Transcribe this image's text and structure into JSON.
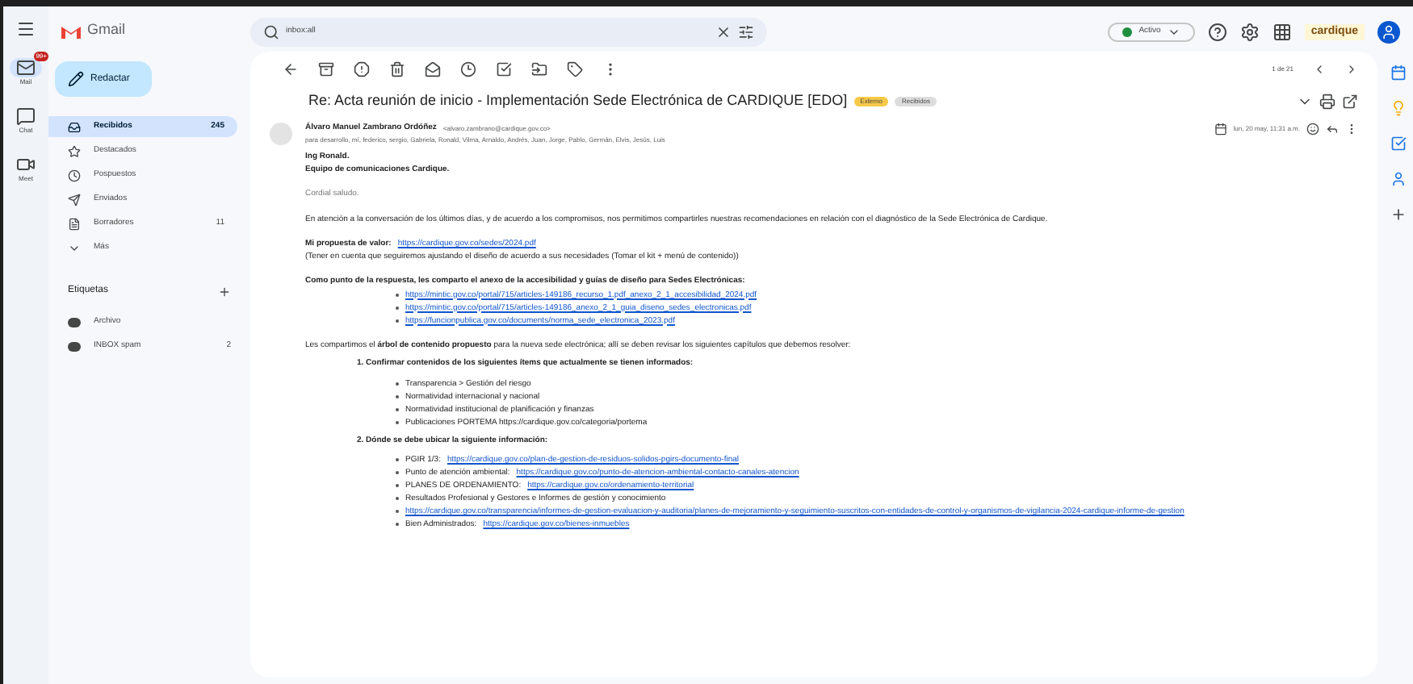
{
  "rail": [
    {
      "label": "Mail",
      "badge": "99+",
      "selected": true
    },
    {
      "label": "Chat",
      "selected": false
    },
    {
      "label": "Meet",
      "selected": false
    }
  ],
  "app_name": "Gmail",
  "compose": "Redactar",
  "folders": [
    {
      "label": "Recibidos",
      "count": "245",
      "selected": true
    },
    {
      "label": "Destacados",
      "selected": false
    },
    {
      "label": "Pospuestos",
      "selected": false
    },
    {
      "label": "Enviados",
      "selected": false
    },
    {
      "label": "Borradores",
      "count": "11",
      "selected": false
    },
    {
      "label": "Más",
      "selected": false
    }
  ],
  "labels_heading": "Etiquetas",
  "labels": [
    {
      "label": "Archivo",
      "color": "#444746"
    },
    {
      "label": "INBOX spam",
      "color": "#444746",
      "count": "2"
    }
  ],
  "search": {
    "value": "inbox:all"
  },
  "status": "Activo",
  "brand": "cardique",
  "pager": "1 de 21",
  "subject": "Re: Acta reunión de inicio - Implementación Sede Electrónica de CARDIQUE [EDO]",
  "subject_tags": [
    {
      "label": "Externo",
      "color": "#f7c948"
    },
    {
      "label": "Recibidos",
      "color": "#dddddd"
    }
  ],
  "sender": {
    "name": "Álvaro Manuel Zambrano Ordóñez",
    "address": "<alvaro.zambrano@cardique.gov.co>",
    "to": "para desarrollo, mí, federico, sergio, Gabriela, Ronald, Vilma, Arnaldo, Andrés, Juan, Jorge, Pablo, Germán, Elvis, Jesús, Luis",
    "date": "lun, 20 may, 11:31 a.m."
  },
  "body": [
    {
      "kind": "bold",
      "text": "Ing Ronald."
    },
    {
      "kind": "bold",
      "text": "Equipo de comunicaciones Cardique."
    },
    {
      "kind": "gap"
    },
    {
      "kind": "muted",
      "text": "Cordial saludo."
    },
    {
      "kind": "gap"
    },
    {
      "kind": "plain",
      "text": "En atención a la conversación de los últimos días, y de acuerdo a los compromisos, nos permitimos compartirles nuestras recomendaciones en relación con el diagnóstico de la Sede Electrónica de Cardique."
    },
    {
      "kind": "gap"
    },
    {
      "kind": "link_line",
      "label": "Mi propuesta de valor:",
      "link": "https://cardique.gov.co/sedes/2024.pdf"
    },
    {
      "kind": "plain",
      "text": "(Tener en cuenta que seguiremos ajustando el diseño de acuerdo a sus necesidades (Tomar el kit + menú de contenido))"
    },
    {
      "kind": "gap"
    },
    {
      "kind": "bold",
      "text": "Como punto de la respuesta, les comparto el anexo de la accesibilidad y guías de diseño para Sedes Electrónicas:"
    },
    {
      "kind": "bullet",
      "link": true,
      "text": "https://mintic.gov.co/portal/715/articles-149186_recurso_1.pdf_anexo_2_1_accesibilidad_2024.pdf"
    },
    {
      "kind": "bullet",
      "link": true,
      "text": "https://mintic.gov.co/portal/715/articles-149186_anexo_2_1_guia_diseno_sedes_electronicas.pdf"
    },
    {
      "kind": "bullet",
      "link": true,
      "text": "https://funcionpublica.gov.co/documents/norma_sede_electronica_2023.pdf"
    },
    {
      "kind": "gap"
    },
    {
      "kind": "rich",
      "text": "Les compartimos el **árbol de contenido propuesto** para la nueva sede electrónica; allí se deben revisar los siguientes capítulos que debemos resolver:"
    },
    {
      "kind": "number",
      "text": "1. Confirmar contenidos de los siguientes ítems que actualmente se tienen informados:"
    },
    {
      "kind": "bullet",
      "text": "Transparencia > Gestión del riesgo"
    },
    {
      "kind": "bullet",
      "text": "Normatividad internacional y nacional"
    },
    {
      "kind": "bullet",
      "text": "Normatividad institucional de planificación y finanzas"
    },
    {
      "kind": "bullet",
      "text": "Publicaciones PORTEMA https://cardique.gov.co/categoria/portema"
    },
    {
      "kind": "number",
      "text": "2. Dónde se debe ubicar la siguiente información:"
    },
    {
      "kind": "bullet",
      "mixed": true,
      "text": "PGIR 1/3:",
      "link": "https://cardique.gov.co/plan-de-gestion-de-residuos-solidos-pgirs-documento-final"
    },
    {
      "kind": "bullet",
      "mixed": true,
      "text": "Punto de atención ambiental:",
      "link": "https://cardique.gov.co/punto-de-atencion-ambiental-contacto-canales-atencion"
    },
    {
      "kind": "bullet",
      "mixed": true,
      "text": "PLANES DE ORDENAMIENTO:",
      "link": "https://cardique.gov.co/ordenamiento-territorial"
    },
    {
      "kind": "bullet",
      "text": "Resultados Profesional y Gestores e Informes de gestión y conocimiento"
    },
    {
      "kind": "bullet",
      "link": true,
      "text": "https://cardique.gov.co/transparencia/informes-de-gestion-evaluacion-y-auditoria/planes-de-mejoramiento-y-seguimiento-suscritos-con-entidades-de-control-y-organismos-de-vigilancia-2024-cardique-informe-de-gestion"
    },
    {
      "kind": "bullet",
      "mixed": true,
      "text": "Bien Administrados:",
      "link": "https://cardique.gov.co/bienes-inmuebles"
    }
  ]
}
